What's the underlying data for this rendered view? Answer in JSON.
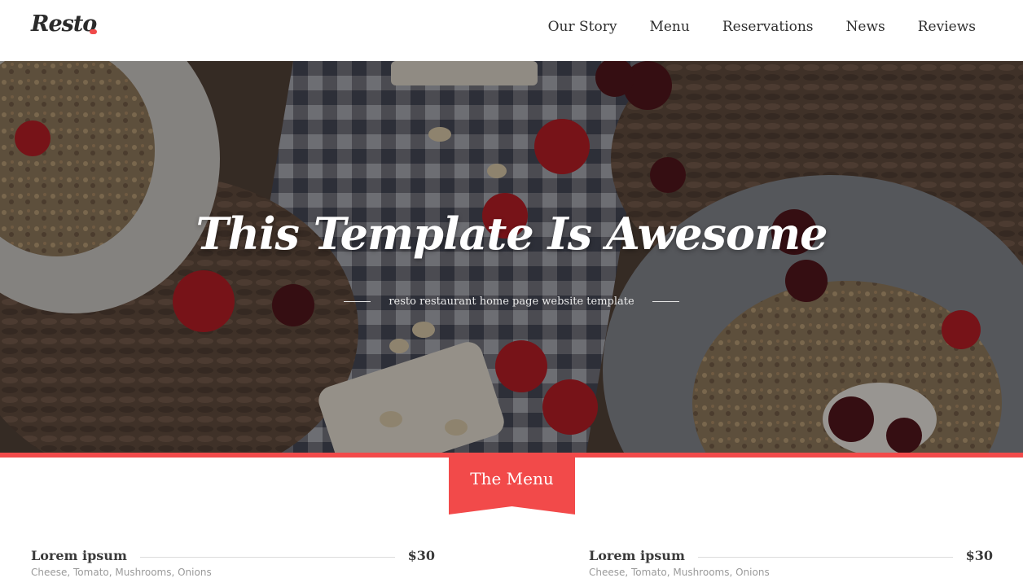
{
  "header": {
    "logo": "Resto",
    "nav": [
      "Our Story",
      "Menu",
      "Reservations",
      "News",
      "Reviews"
    ]
  },
  "hero": {
    "title": "This Template Is Awesome",
    "subtitle": "resto restaurant home page website template"
  },
  "menu_section": {
    "title": "The Menu",
    "items": [
      {
        "name": "Lorem ipsum",
        "price": "$30",
        "desc": "Cheese, Tomato, Mushrooms, Onions"
      },
      {
        "name": "Lorem ipsum",
        "price": "$30",
        "desc": "Cheese, Tomato, Mushrooms, Onions"
      }
    ]
  },
  "colors": {
    "accent": "#f24a4a",
    "text": "#2f2f2f"
  }
}
